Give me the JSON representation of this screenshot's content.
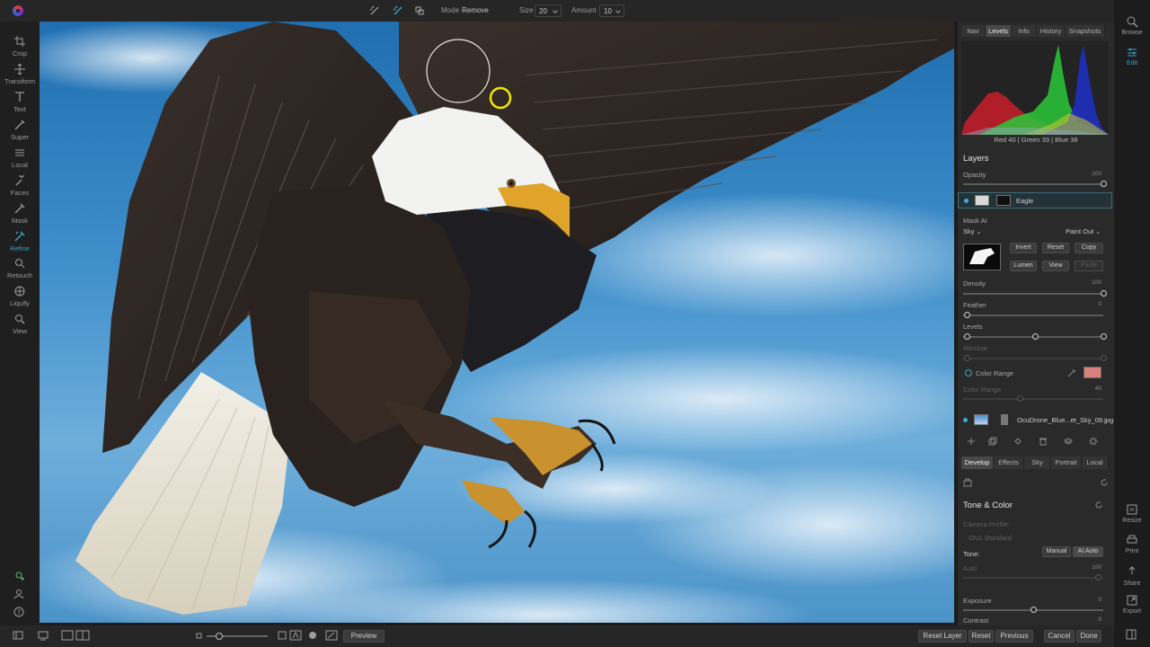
{
  "toolbar": {
    "mode_label": "Mode",
    "mode_value": "Remove",
    "size_label": "Size",
    "size_value": "20",
    "amount_label": "Amount",
    "amount_value": "10"
  },
  "left_tools": [
    {
      "label": "Crop",
      "icon": "crop-icon"
    },
    {
      "label": "Transform",
      "icon": "transform-icon"
    },
    {
      "label": "Text",
      "icon": "text-icon"
    },
    {
      "label": "Super",
      "icon": "super-icon"
    },
    {
      "label": "Local",
      "icon": "local-icon"
    },
    {
      "label": "Faces",
      "icon": "faces-icon"
    },
    {
      "label": "Mask",
      "icon": "mask-icon"
    },
    {
      "label": "Refine",
      "icon": "refine-icon",
      "active": true
    },
    {
      "label": "Retouch",
      "icon": "retouch-icon"
    },
    {
      "label": "Liquify",
      "icon": "liquify-icon"
    },
    {
      "label": "View",
      "icon": "view-icon"
    }
  ],
  "panel": {
    "top_tabs": [
      "Nav",
      "Levels",
      "Info",
      "History",
      "Snapshots"
    ],
    "active_top_tab": "Levels",
    "histogram_readout": "Red  40  | Green  39  | Blue  38",
    "layers_title": "Layers",
    "opacity_label": "Opacity",
    "opacity_value": "100",
    "opacity": 100,
    "layer_eagle": "Eagle",
    "mask_ai_label": "Mask AI",
    "mask_subject": "Sky",
    "mask_mode": "Paint Out",
    "buttons": {
      "invert": "Invert",
      "reset": "Reset",
      "copy": "Copy",
      "lumen": "Lumen",
      "view": "View",
      "paste": "Paste"
    },
    "density_label": "Density",
    "density_value": "100",
    "feather_label": "Feather",
    "feather_value": "0",
    "levels_label": "Levels",
    "window_label": "Window",
    "color_range_label": "Color Range",
    "color_range_swatch": "#d9817b",
    "color_range_sub_label": "Color Range",
    "color_range_sub_value": "40",
    "layer_sky": "OcuDrone_Blue...et_Sky_09.jpg",
    "bottom_tabs": [
      "Develop",
      "Effects",
      "Sky",
      "Portrait",
      "Local"
    ],
    "active_bottom_tab": "Develop",
    "tone_title": "Tone & Color",
    "camera_profile_label": "Camera Profile:",
    "camera_profile_value": "ON1 Standard",
    "tone_label": "Tone:",
    "manual_label": "Manual",
    "ai_auto_label": "AI Auto",
    "auto_label": "Auto",
    "auto_value": "100",
    "exposure_label": "Exposure",
    "exposure_value": "0",
    "contrast_label": "Contrast",
    "contrast_value": "0"
  },
  "right_rail": {
    "browse": "Browse",
    "edit": "Edit",
    "resize": "Resize",
    "print": "Print",
    "share": "Share",
    "export": "Export",
    "ai_badge": "AI"
  },
  "bottom": {
    "preview": "Preview",
    "reset_layer": "Reset Layer",
    "reset": "Reset",
    "previous": "Previous",
    "cancel": "Cancel",
    "done": "Done"
  },
  "colors": {
    "accent": "#34a8c8",
    "sky": "#3f8fcb",
    "brush_cursor": "#f2e600"
  }
}
